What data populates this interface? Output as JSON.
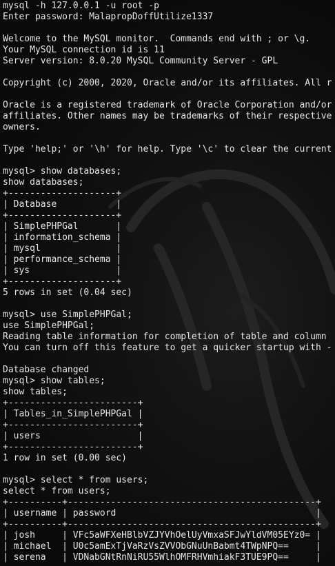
{
  "terminal": {
    "lines": [
      "mysql -h 127.0.0.1 -u root -p",
      "Enter password: MalapropDoffUtilize1337",
      "",
      "Welcome to the MySQL monitor.  Commands end with ; or \\g.",
      "Your MySQL connection id is 11",
      "Server version: 8.0.20 MySQL Community Server - GPL",
      "",
      "Copyright (c) 2000, 2020, Oracle and/or its affiliates. All r",
      "",
      "Oracle is a registered trademark of Oracle Corporation and/or",
      "affiliates. Other names may be trademarks of their respective",
      "owners.",
      "",
      "Type 'help;' or '\\h' for help. Type '\\c' to clear the current",
      "",
      "mysql> show databases;",
      "show databases;",
      "+--------------------+",
      "| Database           |",
      "+--------------------+",
      "| SimplePHPGal       |",
      "| information_schema |",
      "| mysql              |",
      "| performance_schema |",
      "| sys                |",
      "+--------------------+",
      "5 rows in set (0.04 sec)",
      "",
      "mysql> use SimplePHPGal;",
      "use SimplePHPGal;",
      "Reading table information for completion of table and column",
      "You can turn off this feature to get a quicker startup with -",
      "",
      "Database changed",
      "mysql> show tables;",
      "show tables;",
      "+------------------------+",
      "| Tables_in_SimplePHPGal |",
      "+------------------------+",
      "| users                  |",
      "+------------------------+",
      "1 row in set (0.00 sec)",
      "",
      "mysql> select * from users;",
      "select * from users;",
      "+----------+----------------------------------------------+",
      "| username | password                                     |",
      "+----------+----------------------------------------------+",
      "| josh     | VFc5aWFXeHBlbVZJYVhOelUyVmxaSFJwYldVM05EYz0= |",
      "| michael  | U0c5amExTjVaRzVsZVVObGNuUnBabmt4TWpNPQ==     |",
      "| serena   | VDNabGNtRnNiRU55WlhOMFRHVmhiakF3TUE9PQ==     |"
    ]
  }
}
